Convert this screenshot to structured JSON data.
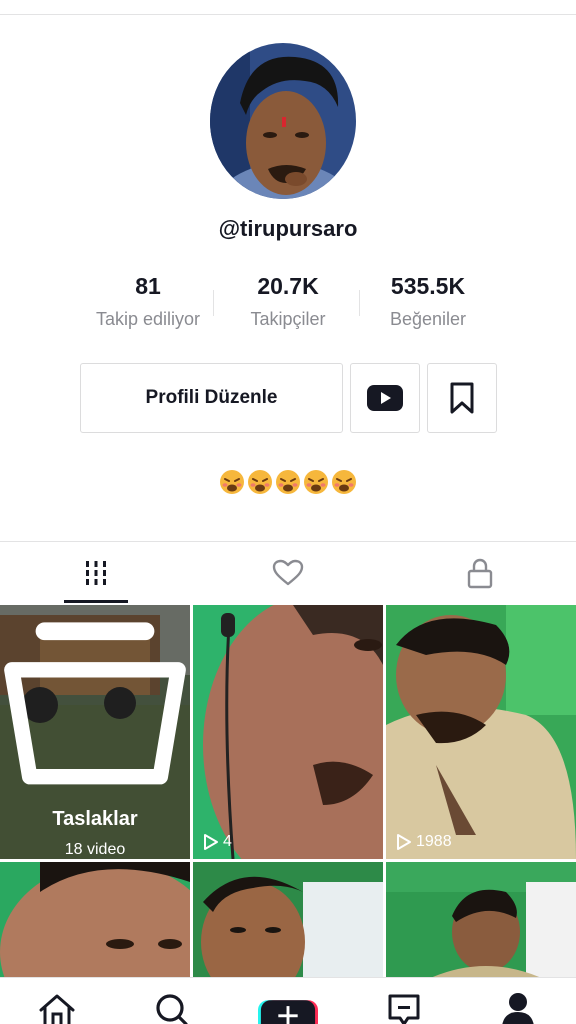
{
  "profile": {
    "username": "@tirupursaro",
    "bio_emojis": [
      "weary-face",
      "weary-face",
      "weary-face",
      "weary-face",
      "weary-face"
    ]
  },
  "stats": [
    {
      "value": "81",
      "label": "Takip ediliyor"
    },
    {
      "value": "20.7K",
      "label": "Takipçiler"
    },
    {
      "value": "535.5K",
      "label": "Beğeniler"
    }
  ],
  "actions": {
    "edit_label": "Profili Düzenle",
    "youtube_icon": "youtube-icon",
    "bookmark_icon": "bookmark-icon"
  },
  "tabs": [
    {
      "icon": "grid-icon",
      "active": true
    },
    {
      "icon": "heart-icon",
      "active": false
    },
    {
      "icon": "lock-icon",
      "active": false
    }
  ],
  "videos": {
    "drafts": {
      "title": "Taslaklar",
      "count_label": "18 video"
    },
    "items": [
      {
        "plays": "4"
      },
      {
        "plays": "1988"
      }
    ]
  },
  "nav": [
    {
      "icon": "home-icon"
    },
    {
      "icon": "discover-icon"
    },
    {
      "icon": "create-icon"
    },
    {
      "icon": "inbox-icon"
    },
    {
      "icon": "profile-icon"
    }
  ],
  "colors": {
    "text": "#161823",
    "muted": "#8a8b91",
    "divider": "#e3e3e4",
    "brand_cyan": "#25f4ee",
    "brand_red": "#fe2c55"
  }
}
